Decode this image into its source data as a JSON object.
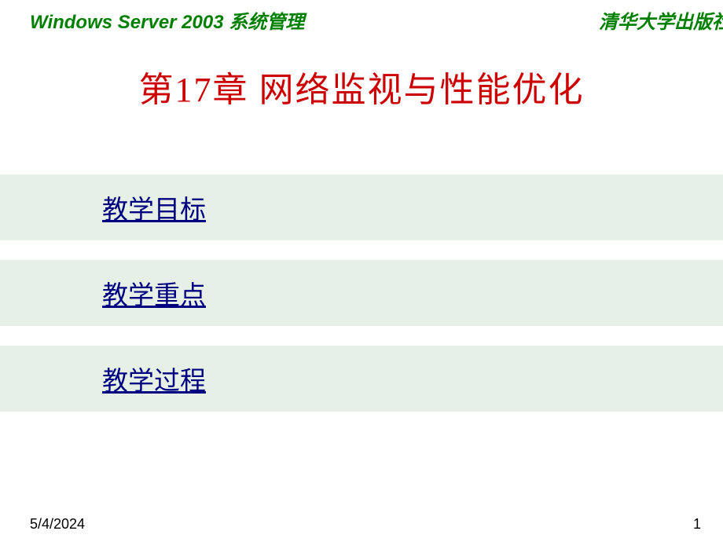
{
  "header": {
    "left": "Windows Server 2003 系统管理",
    "right": "清华大学出版社"
  },
  "title": "第17章  网络监视与性能优化",
  "listItems": [
    "教学目标",
    "教学重点",
    "教学过程"
  ],
  "footer": {
    "date": "5/4/2024",
    "page": "1"
  }
}
